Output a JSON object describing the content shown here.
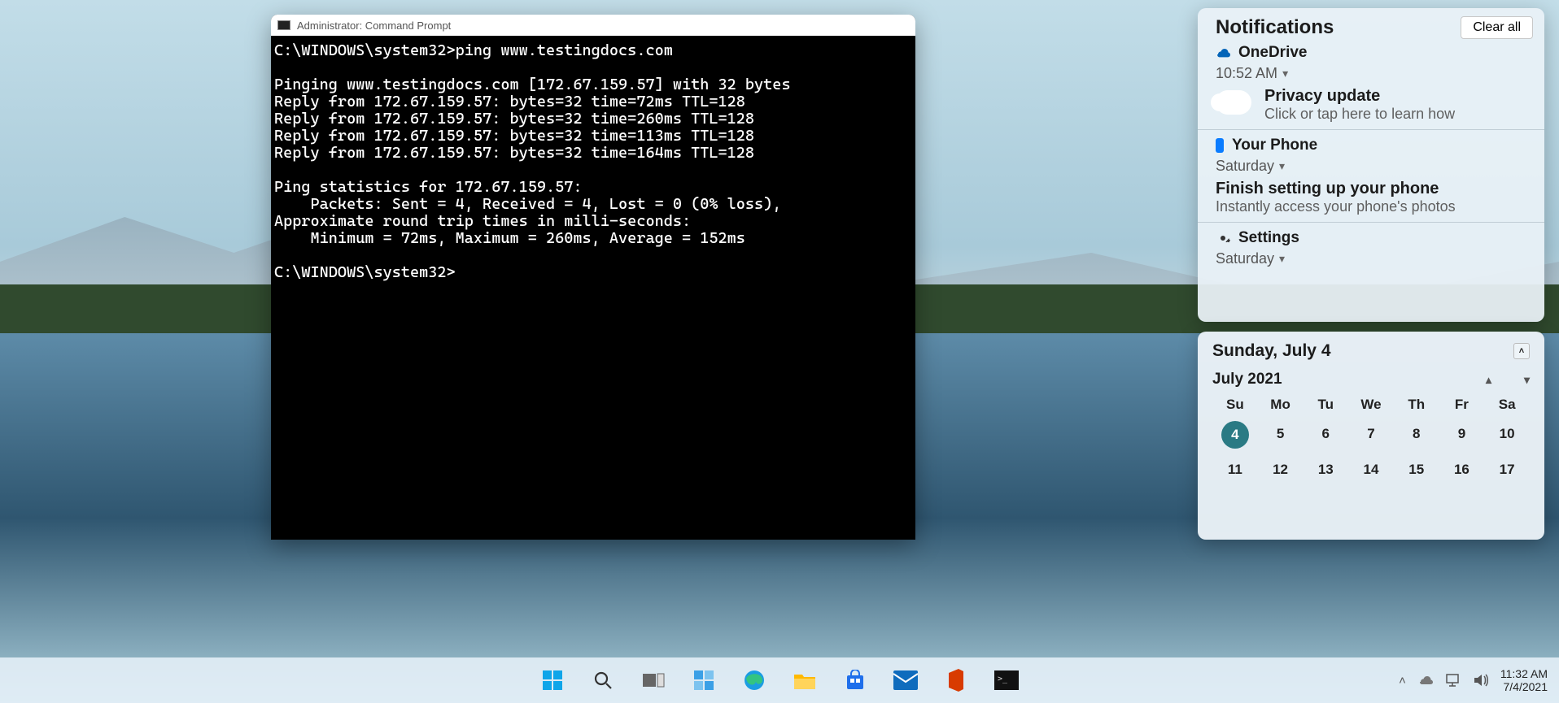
{
  "cmd": {
    "title": "Administrator: Command Prompt",
    "lines": [
      "C:\\WINDOWS\\system32>ping www.testingdocs.com",
      "",
      "Pinging www.testingdocs.com [172.67.159.57] with 32 bytes",
      "Reply from 172.67.159.57: bytes=32 time=72ms TTL=128",
      "Reply from 172.67.159.57: bytes=32 time=260ms TTL=128",
      "Reply from 172.67.159.57: bytes=32 time=113ms TTL=128",
      "Reply from 172.67.159.57: bytes=32 time=164ms TTL=128",
      "",
      "Ping statistics for 172.67.159.57:",
      "    Packets: Sent = 4, Received = 4, Lost = 0 (0% loss),",
      "Approximate round trip times in milli-seconds:",
      "    Minimum = 72ms, Maximum = 260ms, Average = 152ms",
      "",
      "C:\\WINDOWS\\system32>"
    ]
  },
  "notifications": {
    "header": "Notifications",
    "clear": "Clear all",
    "groups": [
      {
        "icon": "onedrive",
        "app": "OneDrive",
        "time": "10:52 AM",
        "title": "Privacy update",
        "sub": "Click or tap here to learn how"
      },
      {
        "icon": "phone",
        "app": "Your Phone",
        "time": "Saturday",
        "title": "Finish setting up your phone",
        "sub": "Instantly access your phone's photos"
      },
      {
        "icon": "settings",
        "app": "Settings",
        "time": "Saturday"
      }
    ]
  },
  "calendar": {
    "today_label": "Sunday, July 4",
    "month_label": "July 2021",
    "dow": [
      "Su",
      "Mo",
      "Tu",
      "We",
      "Th",
      "Fr",
      "Sa"
    ],
    "rows": [
      [
        "4",
        "5",
        "6",
        "7",
        "8",
        "9",
        "10"
      ],
      [
        "11",
        "12",
        "13",
        "14",
        "15",
        "16",
        "17"
      ]
    ],
    "selected": "4"
  },
  "taskbar": {
    "time": "11:32 AM",
    "date": "7/4/2021"
  }
}
